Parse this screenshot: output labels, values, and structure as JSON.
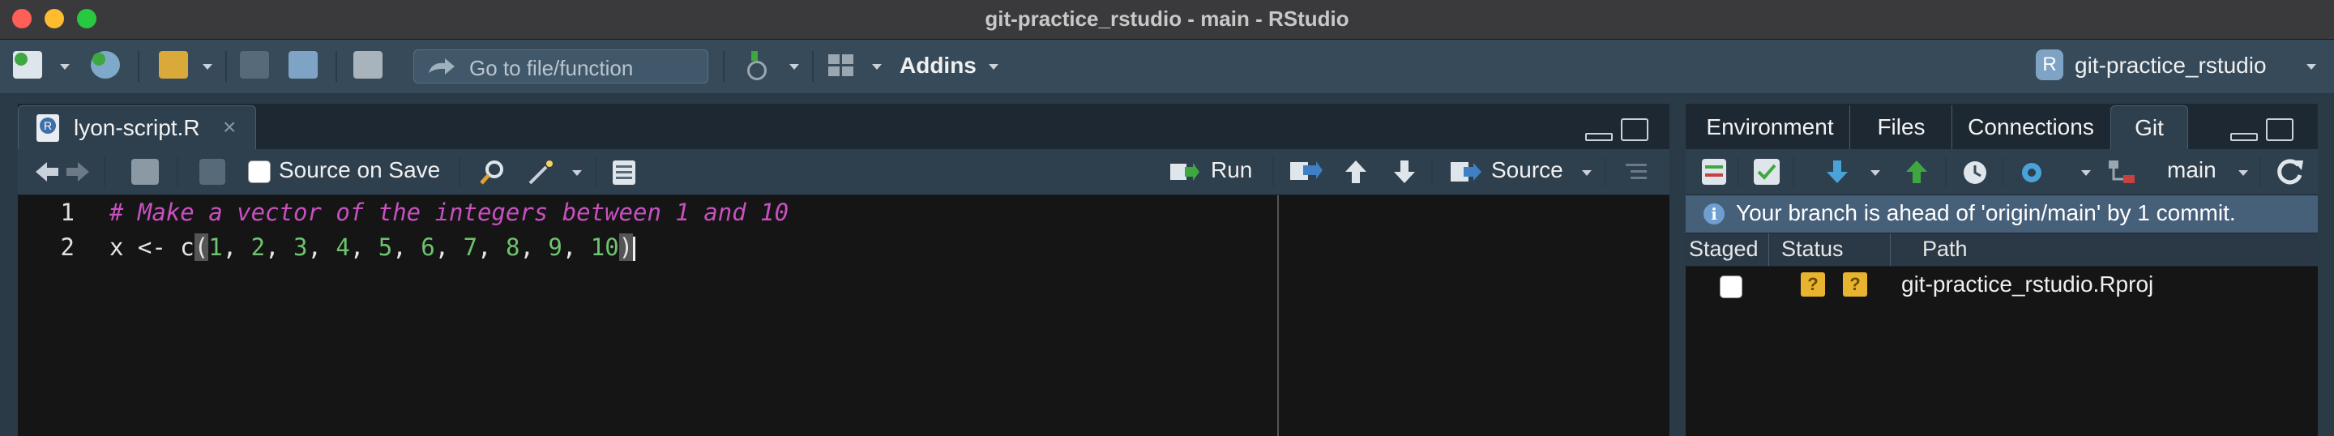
{
  "window": {
    "title": "git-practice_rstudio - main - RStudio"
  },
  "toolbar": {
    "goto_placeholder": "Go to file/function",
    "addins_label": "Addins",
    "project_label": "git-practice_rstudio"
  },
  "editor": {
    "tab_label": "lyon-script.R",
    "source_on_save_label": "Source on Save",
    "run_label": "Run",
    "source_label": "Source",
    "lines": [
      {
        "number": "1",
        "text": "# Make a vector of the integers between 1 and 10"
      },
      {
        "number": "2",
        "text": "x <- c(1, 2, 3, 4, 5, 6, 7, 8, 9, 10)"
      }
    ]
  },
  "right_pane": {
    "tabs": [
      "Environment",
      "Files",
      "Connections",
      "Git"
    ],
    "active_tab": "Git",
    "branch_label": "main",
    "info_message": "Your branch is ahead of 'origin/main' by 1 commit.",
    "columns": {
      "staged": "Staged",
      "status": "Status",
      "path": "Path"
    },
    "files": [
      {
        "path": "git-practice_rstudio.Rproj",
        "status": [
          "?",
          "?"
        ],
        "staged": false
      }
    ]
  },
  "colors": {
    "comment": "#c850c0",
    "number": "#6fc36f",
    "toolbar_bg": "#364a5a",
    "editor_bg": "#151515",
    "status_badge": "#e8b32e"
  }
}
